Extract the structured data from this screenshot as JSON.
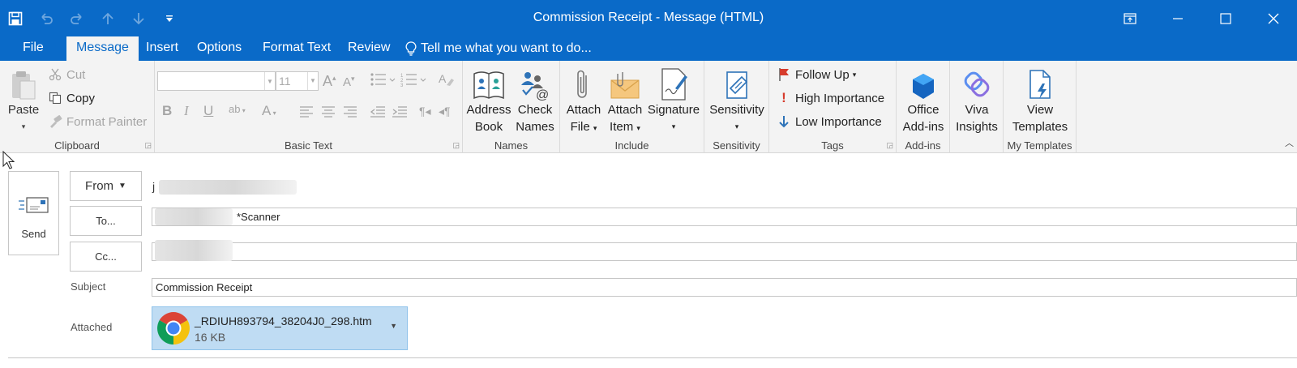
{
  "window": {
    "title": "Commission Receipt - Message (HTML)"
  },
  "quick_access": {
    "save_icon": "save-icon",
    "undo_icon": "undo-icon",
    "redo_icon": "redo-icon",
    "up_icon": "up-arrow-icon",
    "down_icon": "down-arrow-icon",
    "customize_icon": "customize-qat-icon"
  },
  "window_controls": {
    "restore_ribbon": "ribbon-display-icon",
    "minimize": "minimize-icon",
    "maximize": "maximize-icon",
    "close": "close-icon"
  },
  "tabs": [
    {
      "label": "File"
    },
    {
      "label": "Message",
      "active": true
    },
    {
      "label": "Insert"
    },
    {
      "label": "Options"
    },
    {
      "label": "Format Text"
    },
    {
      "label": "Review"
    }
  ],
  "tell_me": "Tell me what you want to do...",
  "ribbon": {
    "clipboard": {
      "label": "Clipboard",
      "paste": "Paste",
      "cut": "Cut",
      "copy": "Copy",
      "format_painter": "Format Painter"
    },
    "basic_text": {
      "label": "Basic Text",
      "font_size": "11"
    },
    "names": {
      "label": "Names",
      "address_book_1": "Address",
      "address_book_2": "Book",
      "check_names_1": "Check",
      "check_names_2": "Names"
    },
    "include": {
      "label": "Include",
      "attach_file_1": "Attach",
      "attach_file_2": "File",
      "attach_item_1": "Attach",
      "attach_item_2": "Item",
      "signature": "Signature"
    },
    "sensitivity": {
      "label": "Sensitivity",
      "button": "Sensitivity"
    },
    "tags": {
      "label": "Tags",
      "follow_up": "Follow Up",
      "high_importance": "High Importance",
      "low_importance": "Low Importance"
    },
    "addins": {
      "label": "Add-ins",
      "office_1": "Office",
      "office_2": "Add-ins"
    },
    "viva": {
      "label_1": "Viva",
      "label_2": "Insights"
    },
    "my_templates": {
      "label": "My Templates",
      "view_1": "View",
      "view_2": "Templates"
    }
  },
  "compose": {
    "send_label": "Send",
    "from_label": "From",
    "from_value": "j",
    "to_label": "To...",
    "to_value": "*Scanner",
    "cc_label": "Cc...",
    "subject_label": "Subject",
    "subject_value": "Commission Receipt",
    "attached_label": "Attached",
    "attachment": {
      "name": "_RDIUH893794_38204J0_298.htm",
      "size": "16 KB",
      "icon": "chrome-icon"
    }
  },
  "colors": {
    "accent": "#0a6ac8",
    "ribbon_bg": "#f3f3f3",
    "attachment_bg": "#bfdcf3"
  }
}
